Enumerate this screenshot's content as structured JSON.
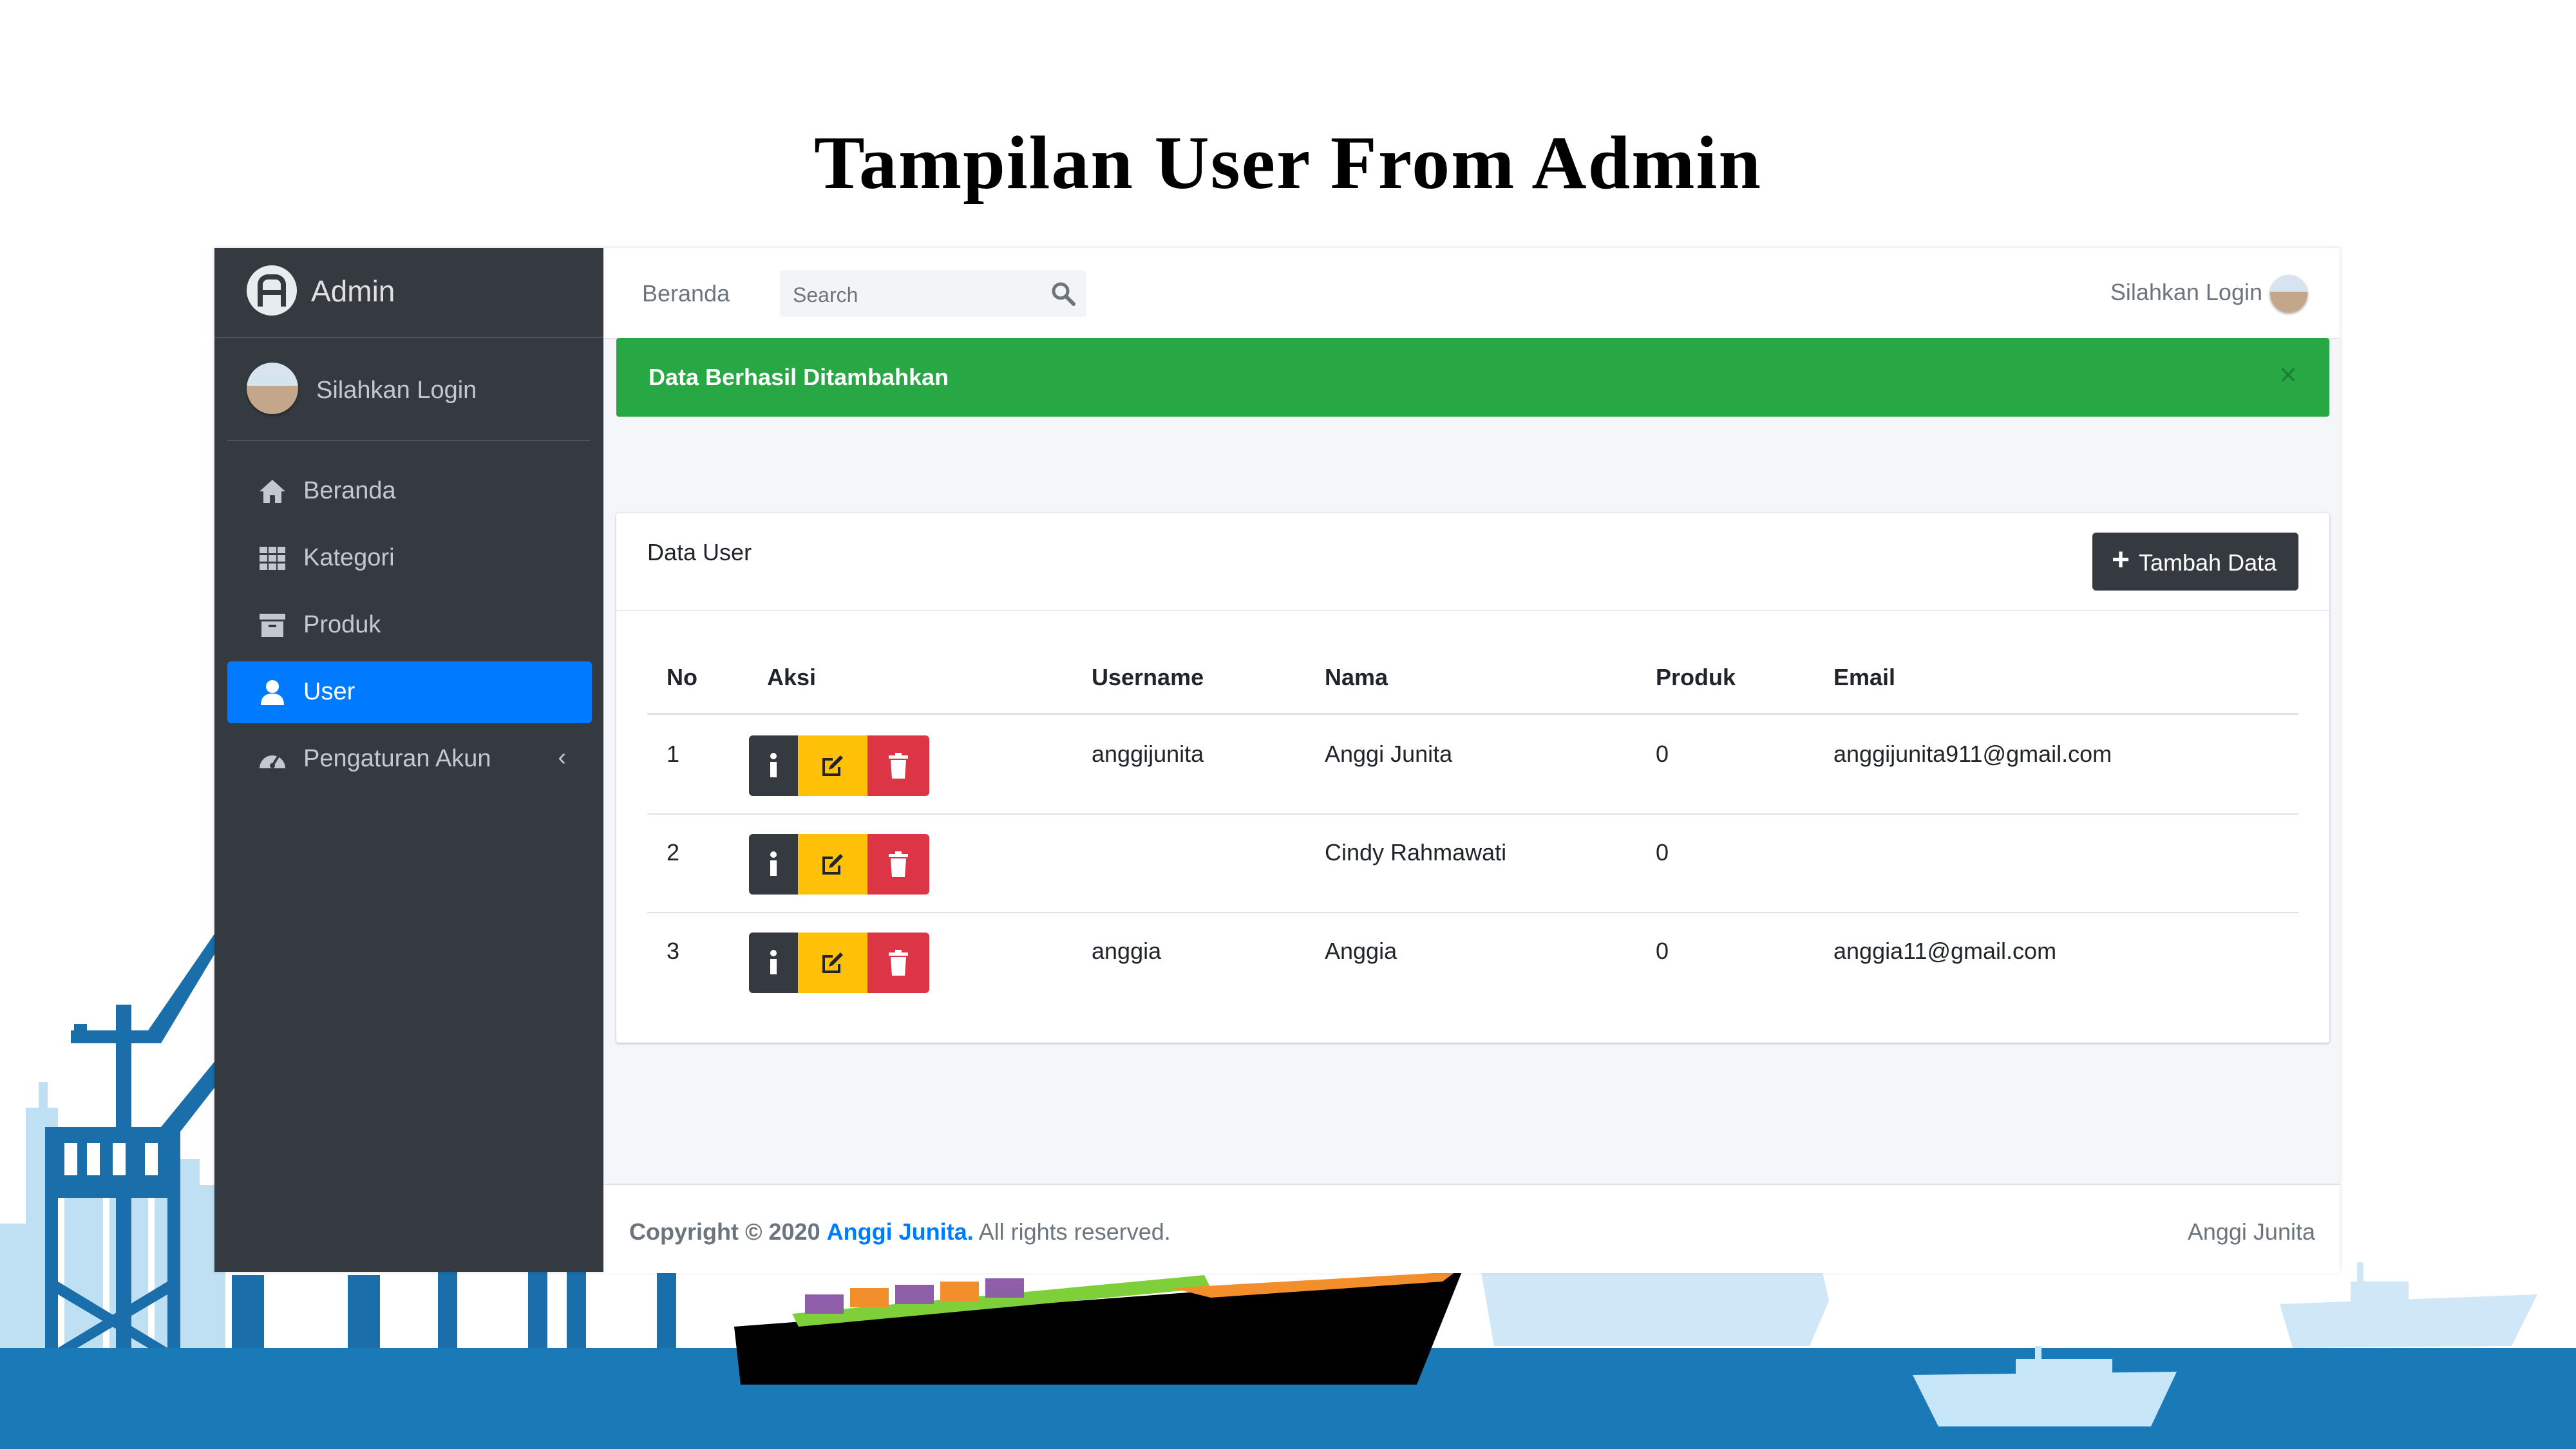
{
  "slide": {
    "title": "Tampilan User From Admin"
  },
  "sidebar": {
    "brand": "Admin",
    "user_name": "Silahkan Login",
    "items": [
      {
        "label": "Beranda",
        "icon": "home-icon"
      },
      {
        "label": "Kategori",
        "icon": "grid-icon"
      },
      {
        "label": "Produk",
        "icon": "archive-icon"
      },
      {
        "label": "User",
        "icon": "user-icon",
        "active": true
      },
      {
        "label": "Pengaturan Akun",
        "icon": "tachometer-icon"
      }
    ]
  },
  "topbar": {
    "home_link": "Beranda",
    "search_placeholder": "Search",
    "user_label": "Silahkan Login"
  },
  "alert": {
    "message": "Data Berhasil Ditambahkan",
    "close": "×"
  },
  "card": {
    "title": "Data User",
    "add_button": "Tambah Data",
    "columns": [
      "No",
      "Aksi",
      "Username",
      "Nama",
      "Produk",
      "Email"
    ],
    "rows": [
      {
        "no": "1",
        "username": "anggijunita",
        "nama": "Anggi Junita",
        "produk": "0",
        "email": "anggijunita911@gmail.com"
      },
      {
        "no": "2",
        "username": "",
        "nama": "Cindy Rahmawati",
        "produk": "0",
        "email": ""
      },
      {
        "no": "3",
        "username": "anggia",
        "nama": "Anggia",
        "produk": "0",
        "email": "anggia11@gmail.com"
      }
    ]
  },
  "footer": {
    "copyright": "Copyright © 2020",
    "brand": "Anggi Junita.",
    "rights": "All rights reserved.",
    "right_text": "Anggi Junita"
  },
  "colors": {
    "sidebar": "#343a40",
    "active": "#007bff",
    "success": "#28a745",
    "warning": "#ffc107",
    "danger": "#dc3545",
    "sea": "#1a7ab8"
  }
}
